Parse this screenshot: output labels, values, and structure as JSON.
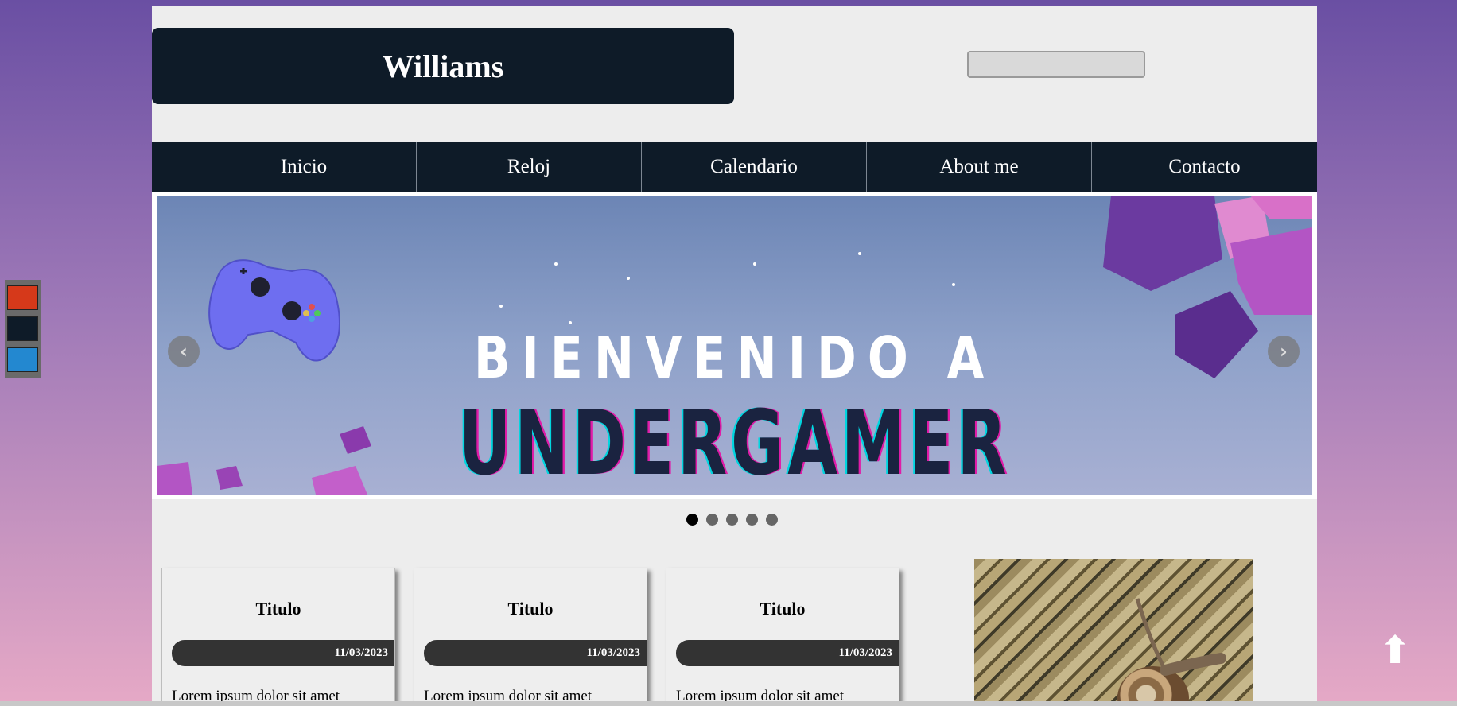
{
  "header": {
    "brand": "Williams",
    "search_value": "",
    "search_placeholder": ""
  },
  "nav": {
    "items": [
      {
        "label": "Inicio"
      },
      {
        "label": "Reloj"
      },
      {
        "label": "Calendario"
      },
      {
        "label": "About me"
      },
      {
        "label": "Contacto"
      }
    ]
  },
  "slider": {
    "line1": "BIENVENIDO A",
    "line2": "UNDERGAMER",
    "prev_icon": "chevron-left-icon",
    "next_icon": "chevron-right-icon",
    "slide_count": 5,
    "active_slide": 1
  },
  "cards": [
    {
      "title": "Titulo",
      "date": "11/03/2023",
      "text": "Lorem ipsum dolor sit amet"
    },
    {
      "title": "Titulo",
      "date": "11/03/2023",
      "text": "Lorem ipsum dolor sit amet"
    },
    {
      "title": "Titulo",
      "date": "11/03/2023",
      "text": "Lorem ipsum dolor sit amet"
    }
  ],
  "theme_switcher": {
    "colors": [
      "#d6391a",
      "#0e1b28",
      "#2388d0"
    ]
  },
  "scroll_top_icon": "arrow-up-icon",
  "colors": {
    "dark": "#0e1b28",
    "page_bg": "#ededed",
    "date_pill": "#333333"
  }
}
